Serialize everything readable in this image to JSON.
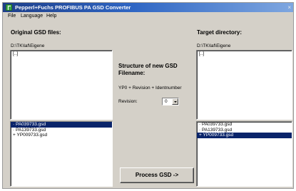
{
  "window": {
    "title": "Pepperl+Fuchs PROFIBUS PA GSD Converter",
    "close_glyph": "×"
  },
  "menu": {
    "items": [
      "File",
      "Language",
      "Help"
    ]
  },
  "left_panel": {
    "title": "Original GSD files:",
    "path": "D:\\TK\\laf\\Eigene",
    "dir_list": [
      "[..]"
    ],
    "files": [
      {
        "label": "· PA039733.gsd",
        "selected": true
      },
      {
        "label": "· PA139733.gsd",
        "selected": false
      },
      {
        "label": "+ YP009733.gsd",
        "selected": false
      }
    ]
  },
  "middle_panel": {
    "heading": "Structure of new GSD Filename:",
    "formula": "YP0 + Revision + Identnumber",
    "revision_label": "Revision:",
    "revision_value": "0",
    "process_button": "Process GSD ->"
  },
  "right_panel": {
    "title": "Target directory:",
    "path": "D:\\TK\\laf\\Eigene",
    "dir_list": [
      "[..]"
    ],
    "files": [
      {
        "label": "· PA039733.gsd",
        "selected": false
      },
      {
        "label": "· PA139733.gsd",
        "selected": false
      },
      {
        "label": "+ YP009733.gsd",
        "selected": true
      }
    ]
  }
}
